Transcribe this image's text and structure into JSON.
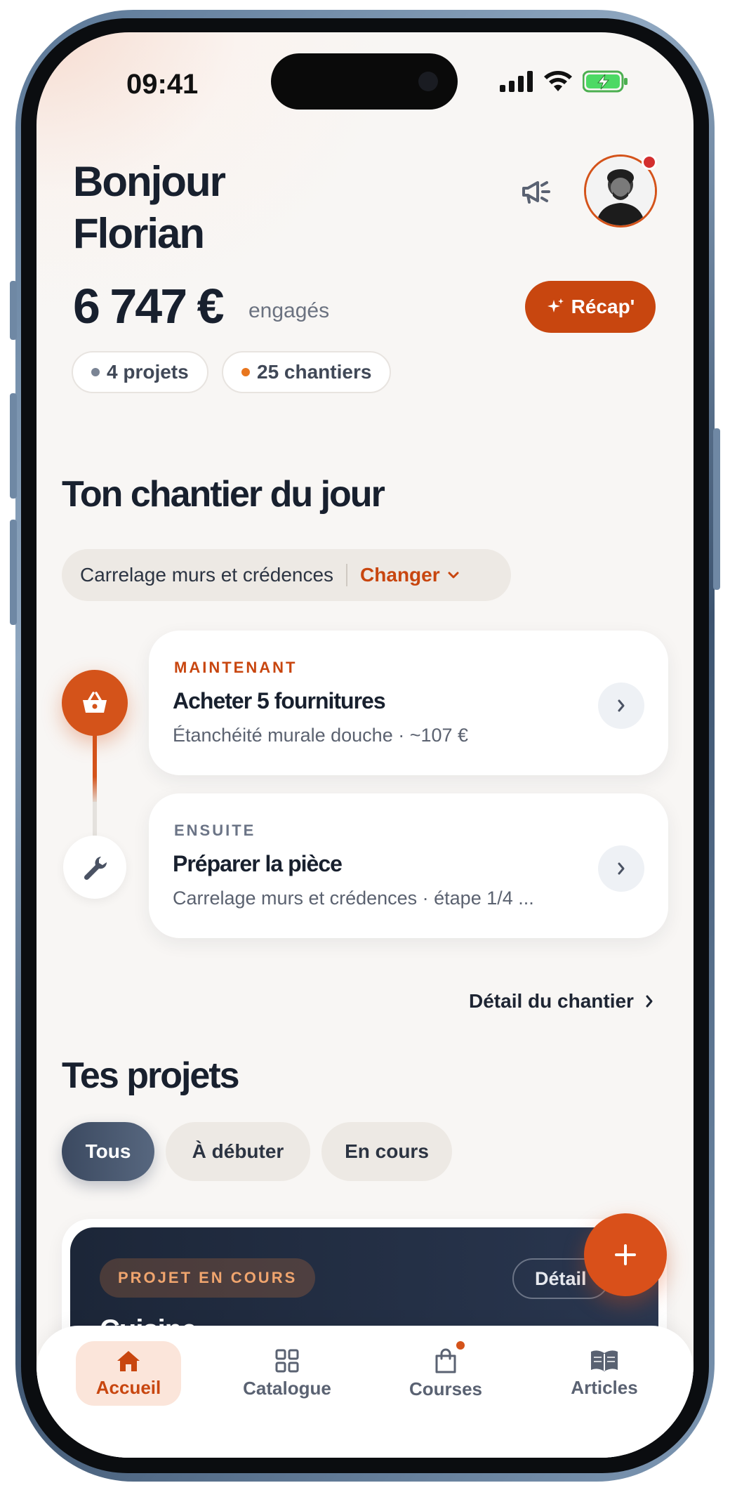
{
  "status_bar": {
    "time": "09:41"
  },
  "header": {
    "greeting_line1": "Bonjour",
    "greeting_line2": "Florian",
    "amount": "6 747 €",
    "amount_suffix": "engagés",
    "recap_label": "Récap'",
    "pills": [
      {
        "label": "4 projets",
        "dot_color": "#7a8494"
      },
      {
        "label": "25 chantiers",
        "dot_color": "#e8761e"
      }
    ]
  },
  "today": {
    "title": "Ton chantier du jour",
    "selector_label": "Carrelage murs et crédences",
    "change_label": "Changer",
    "tasks": [
      {
        "tag": "MAINTENANT",
        "title": "Acheter 5 fournitures",
        "subtitle": "Étanchéité murale douche · ~107 €"
      },
      {
        "tag": "ENSUITE",
        "title": "Préparer la pièce",
        "subtitle": "Carrelage murs et crédences · étape 1/4 ..."
      }
    ],
    "detail_link": "Détail du chantier"
  },
  "projects": {
    "title": "Tes projets",
    "filters": [
      "Tous",
      "À débuter",
      "En cours"
    ],
    "active_filter": "Tous",
    "card": {
      "tag": "PROJET EN COURS",
      "detail_label": "Détail",
      "title": "Cuisine"
    }
  },
  "bottom_nav": {
    "items": [
      {
        "label": "Accueil",
        "icon": "home-icon"
      },
      {
        "label": "Catalogue",
        "icon": "grid-icon"
      },
      {
        "label": "Courses",
        "icon": "shopping-bag-icon"
      },
      {
        "label": "Articles",
        "icon": "book-icon"
      }
    ],
    "active": "Accueil"
  },
  "colors": {
    "accent": "#c8460f",
    "dark": "#1c2638",
    "background": "#f8f6f4"
  }
}
